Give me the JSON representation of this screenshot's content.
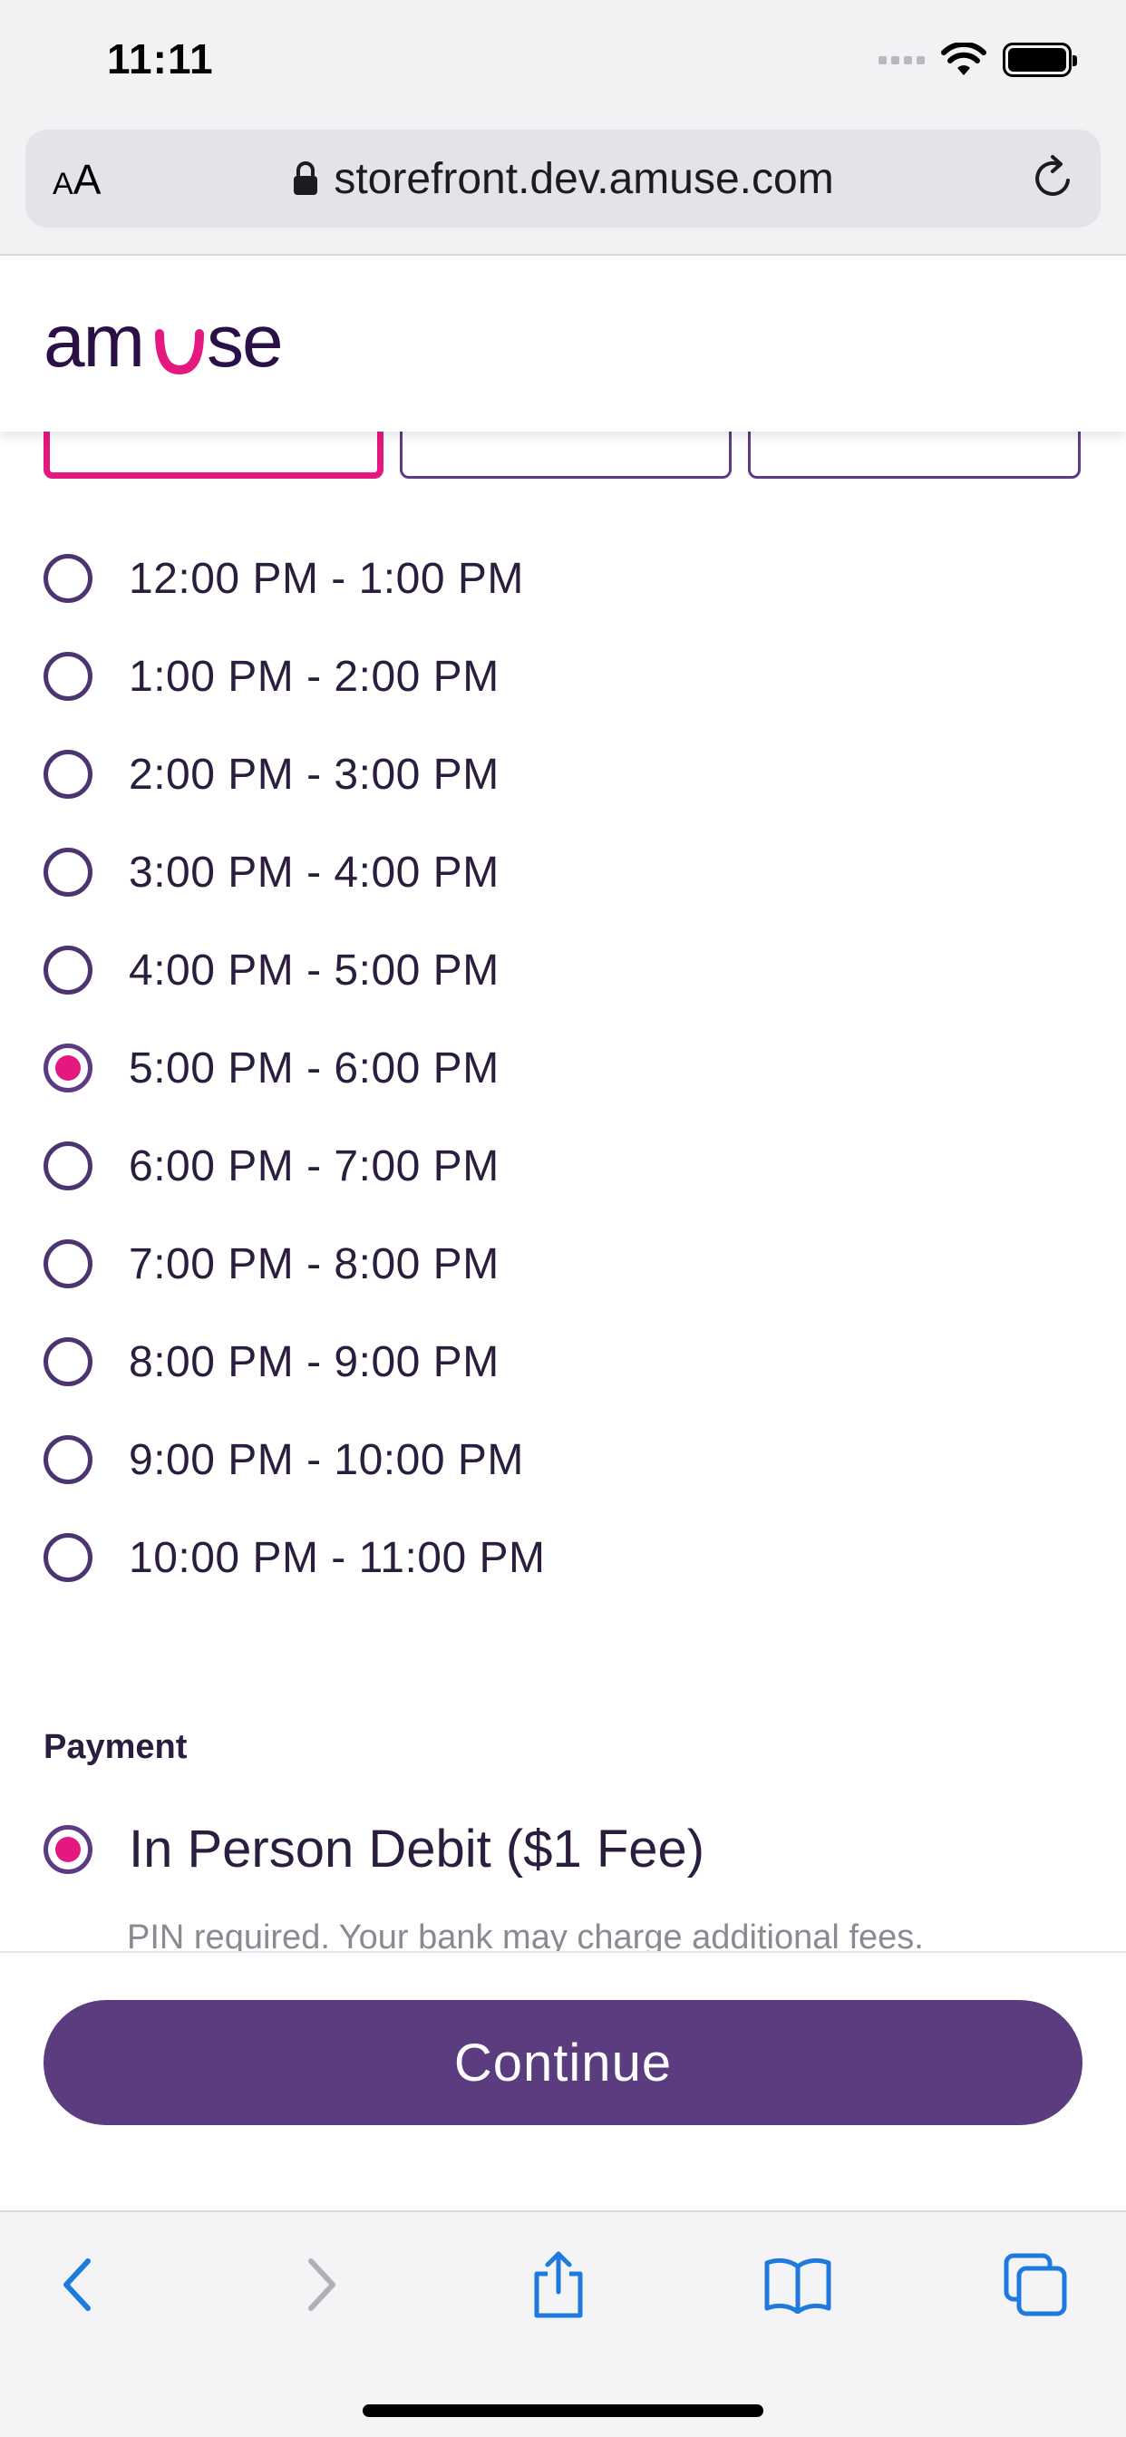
{
  "status_bar": {
    "time": "11:11"
  },
  "browser": {
    "text_size_button": {
      "small": "A",
      "large": "A"
    },
    "url": "storefront.dev.amuse.com"
  },
  "brand": {
    "logo_text": "amuse",
    "accent_color": "#e5187f",
    "primary_color": "#5a3c7f"
  },
  "time_slots": [
    {
      "label": "12:00 PM - 1:00 PM",
      "selected": false
    },
    {
      "label": "1:00 PM - 2:00 PM",
      "selected": false
    },
    {
      "label": "2:00 PM - 3:00 PM",
      "selected": false
    },
    {
      "label": "3:00 PM - 4:00 PM",
      "selected": false
    },
    {
      "label": "4:00 PM - 5:00 PM",
      "selected": false
    },
    {
      "label": "5:00 PM - 6:00 PM",
      "selected": true
    },
    {
      "label": "6:00 PM - 7:00 PM",
      "selected": false
    },
    {
      "label": "7:00 PM - 8:00 PM",
      "selected": false
    },
    {
      "label": "8:00 PM - 9:00 PM",
      "selected": false
    },
    {
      "label": "9:00 PM - 10:00 PM",
      "selected": false
    },
    {
      "label": "10:00 PM - 11:00 PM",
      "selected": false
    }
  ],
  "payment": {
    "title": "Payment",
    "option_label": "In Person Debit ($1 Fee)",
    "option_note": "PIN required. Your bank may charge additional fees.",
    "option_selected": true
  },
  "actions": {
    "continue_label": "Continue"
  },
  "toolbar": {
    "icons": [
      "back-icon",
      "forward-icon",
      "share-icon",
      "bookmarks-icon",
      "tabs-icon"
    ]
  }
}
